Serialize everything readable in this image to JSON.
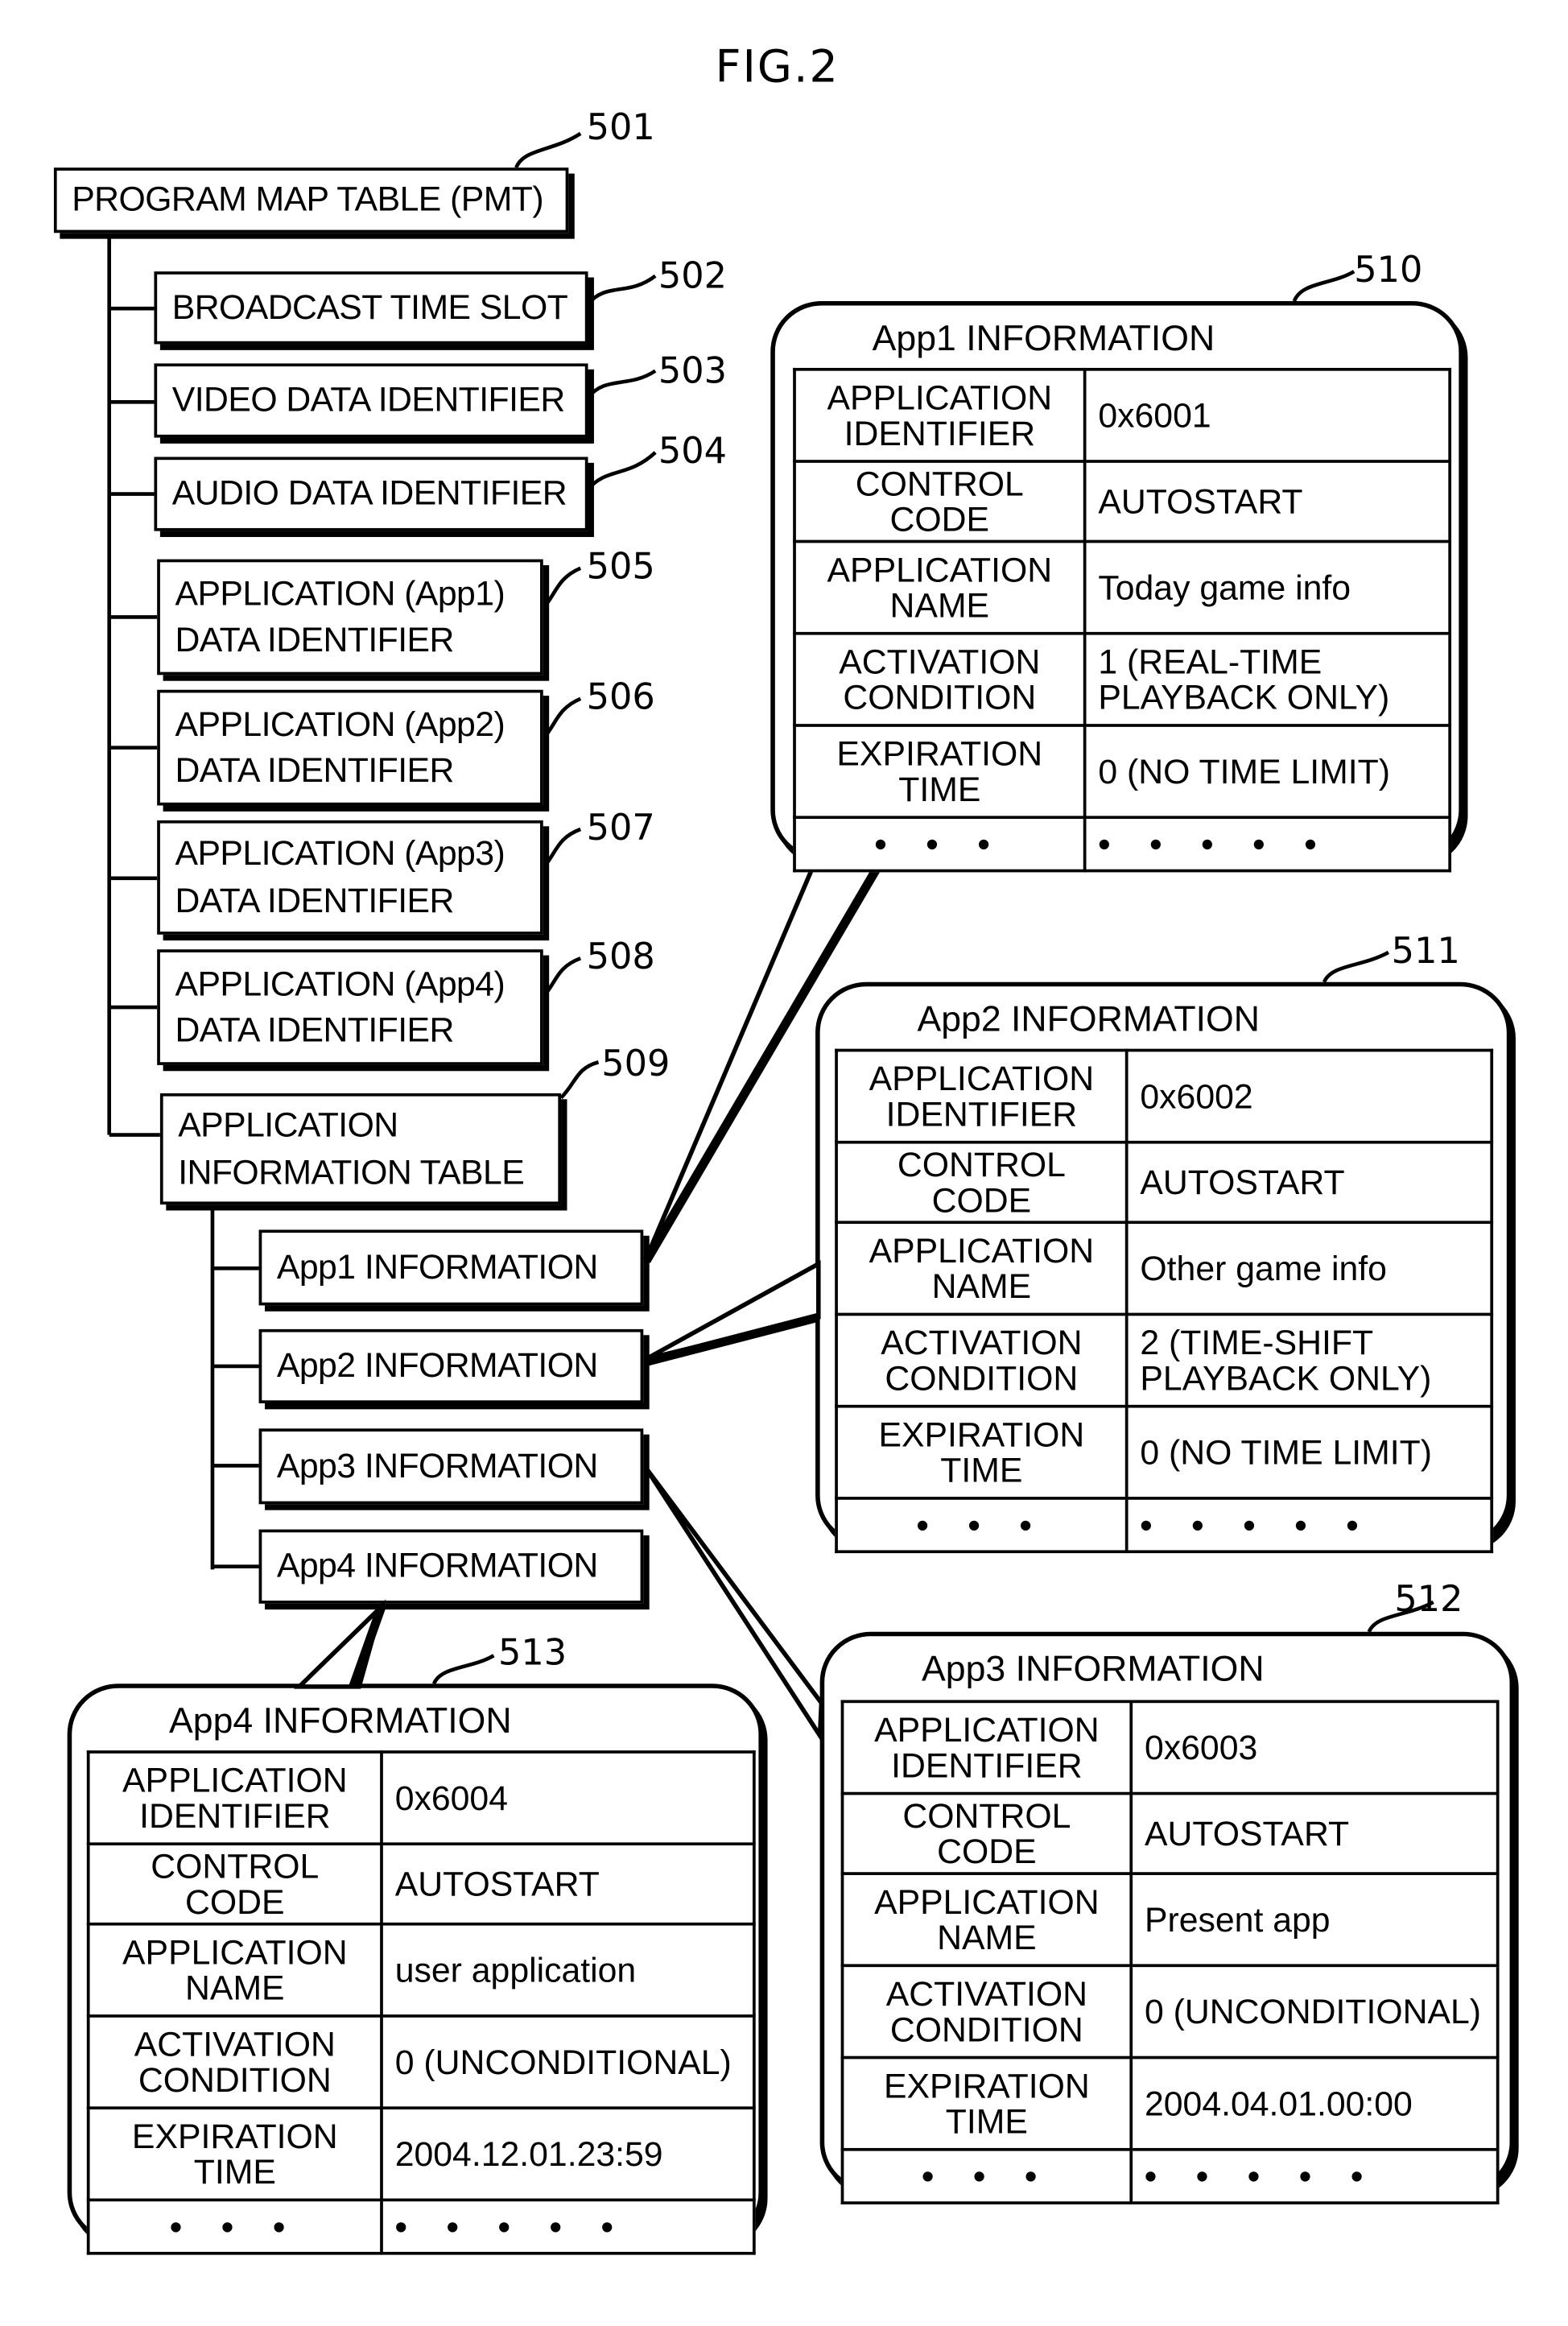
{
  "figure_title": "FIG.2",
  "tree": {
    "root": {
      "label": "PROGRAM MAP TABLE (PMT)",
      "ref": "501"
    },
    "children": [
      {
        "label": "BROADCAST TIME SLOT",
        "ref": "502"
      },
      {
        "label": "VIDEO DATA IDENTIFIER",
        "ref": "503"
      },
      {
        "label": "AUDIO DATA IDENTIFIER",
        "ref": "504"
      },
      {
        "label_line1": "APPLICATION (App1)",
        "label_line2": "DATA IDENTIFIER",
        "ref": "505"
      },
      {
        "label_line1": "APPLICATION (App2)",
        "label_line2": "DATA IDENTIFIER",
        "ref": "506"
      },
      {
        "label_line1": "APPLICATION (App3)",
        "label_line2": "DATA IDENTIFIER",
        "ref": "507"
      },
      {
        "label_line1": "APPLICATION (App4)",
        "label_line2": "DATA IDENTIFIER",
        "ref": "508"
      },
      {
        "label_line1": "APPLICATION",
        "label_line2": "INFORMATION TABLE",
        "ref": "509"
      }
    ],
    "ait_children": [
      {
        "label": "App1 INFORMATION"
      },
      {
        "label": "App2 INFORMATION"
      },
      {
        "label": "App3 INFORMATION"
      },
      {
        "label": "App4 INFORMATION"
      }
    ]
  },
  "field_labels": {
    "app_id_1": "APPLICATION",
    "app_id_2": "IDENTIFIER",
    "control_code": "CONTROL CODE",
    "app_name_1": "APPLICATION",
    "app_name_2": "NAME",
    "activation_1": "ACTIVATION",
    "activation_2": "CONDITION",
    "expiration_1": "EXPIRATION",
    "expiration_2": "TIME",
    "more_key": "• • •",
    "more_value": "• • • • •"
  },
  "info_tables": [
    {
      "ref": "510",
      "title": "App1 INFORMATION",
      "identifier": "0x6001",
      "control_code": "AUTOSTART",
      "name": "Today game info",
      "activation_line1": "1 (REAL-TIME",
      "activation_line2": "PLAYBACK ONLY)",
      "expiration": "0 (NO TIME LIMIT)"
    },
    {
      "ref": "511",
      "title": "App2 INFORMATION",
      "identifier": "0x6002",
      "control_code": "AUTOSTART",
      "name": "Other game info",
      "activation_line1": "2 (TIME-SHIFT",
      "activation_line2": "PLAYBACK ONLY)",
      "expiration": "0 (NO TIME LIMIT)"
    },
    {
      "ref": "512",
      "title": "App3 INFORMATION",
      "identifier": "0x6003",
      "control_code": "AUTOSTART",
      "name": "Present app",
      "activation_line1": "0 (UNCONDITIONAL)",
      "activation_line2": "",
      "expiration": "2004.04.01.00:00"
    },
    {
      "ref": "513",
      "title": "App4 INFORMATION",
      "identifier": "0x6004",
      "control_code": "AUTOSTART",
      "name": "user application",
      "activation_line1": "0 (UNCONDITIONAL)",
      "activation_line2": "",
      "expiration": "2004.12.01.23:59"
    }
  ]
}
